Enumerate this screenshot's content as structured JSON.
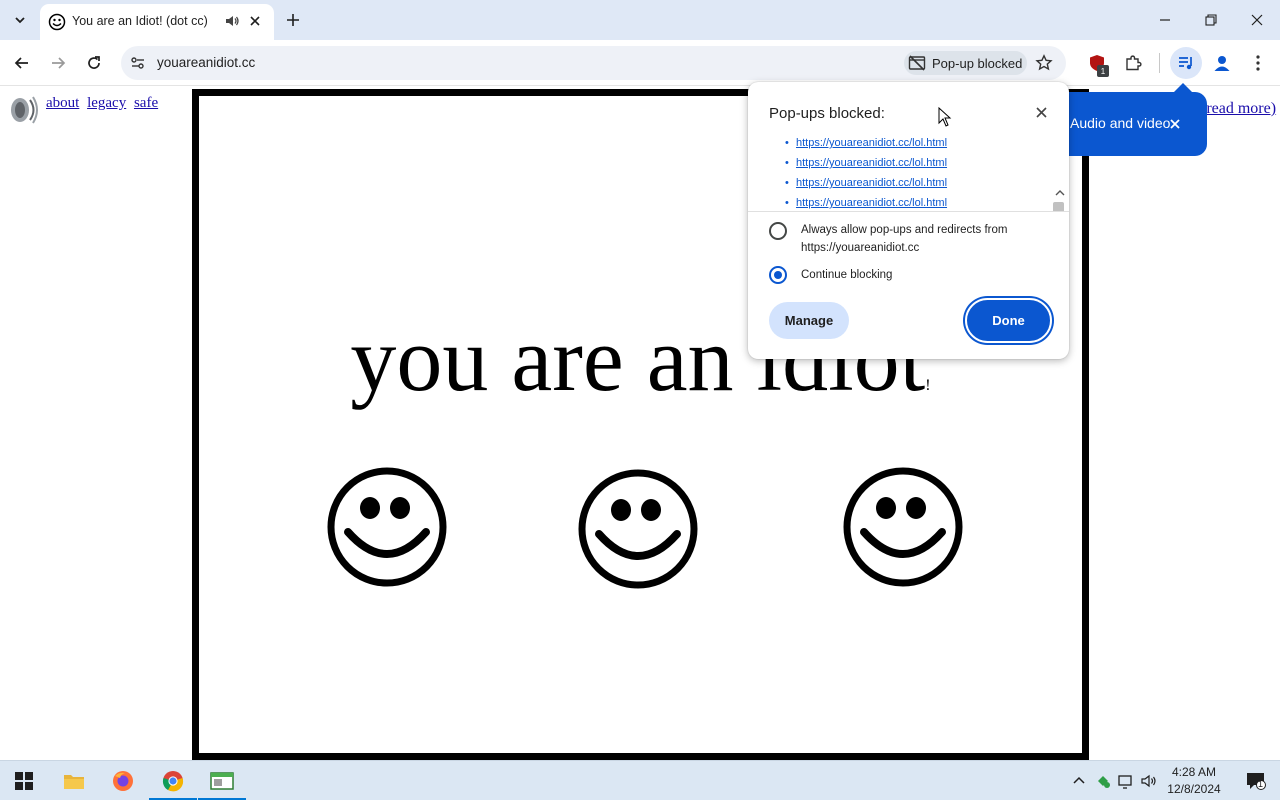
{
  "browser": {
    "tab": {
      "title": "You are an Idiot! (dot cc)"
    },
    "omnibox": {
      "url": "youareanidiot.cc"
    },
    "popup_chip": {
      "label": "Pop-up blocked"
    },
    "extension_badge_count": "1"
  },
  "page": {
    "links": [
      "about",
      "legacy",
      "safe"
    ],
    "headline": "you are an idiot",
    "headline_suffix": "!",
    "read_more": "(read more)"
  },
  "media_toast": {
    "text": "Audio and video"
  },
  "popup_bubble": {
    "title": "Pop-ups blocked:",
    "blocked_urls": [
      "https://youareanidiot.cc/lol.html",
      "https://youareanidiot.cc/lol.html",
      "https://youareanidiot.cc/lol.html",
      "https://youareanidiot.cc/lol.html"
    ],
    "option_allow_line1": "Always allow pop-ups and redirects from",
    "option_allow_line2": "https://youareanidiot.cc",
    "option_block": "Continue blocking",
    "selected_option": "Continue blocking",
    "manage_label": "Manage",
    "done_label": "Done"
  },
  "taskbar": {
    "clock_time": "4:28 AM",
    "clock_date": "12/8/2024",
    "notification_count": "1"
  },
  "colors": {
    "accent": "#0b57d0",
    "tabstrip": "#dfe8f6",
    "taskbar": "#dbe7f3"
  }
}
